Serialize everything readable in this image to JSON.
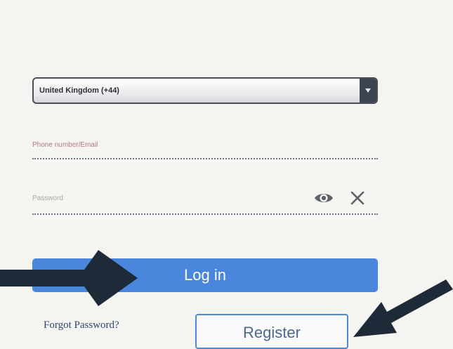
{
  "form": {
    "country_select": {
      "value": "United Kingdom (+44)"
    },
    "phone_email_field": {
      "placeholder": "Phone number/Email"
    },
    "password_field": {
      "placeholder": "Password"
    },
    "login_button": {
      "label": "Log in"
    },
    "forgot_password_link": {
      "label": "Forgot Password?"
    },
    "register_button": {
      "label": "Register"
    }
  },
  "icons": {
    "show_password": "eye-icon",
    "clear_field": "close-icon",
    "select_arrow": "chevron-down-icon"
  },
  "colors": {
    "primary": "#4a87dc",
    "annotation_arrow": "#1e2a38",
    "field_underline": "#6f7582"
  }
}
